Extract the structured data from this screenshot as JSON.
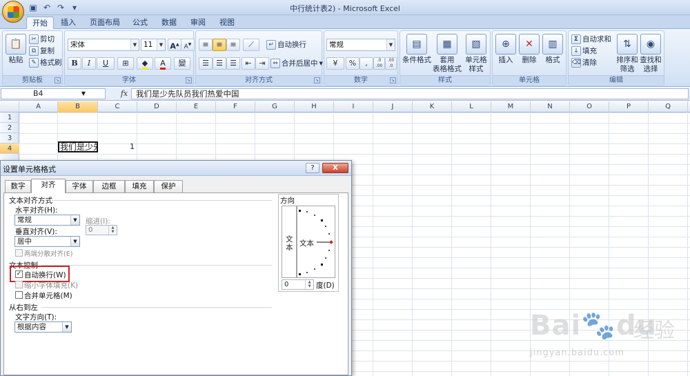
{
  "window": {
    "title": "中行统计表2) - Microsoft Excel"
  },
  "ribbon_tabs": [
    "开始",
    "插入",
    "页面布局",
    "公式",
    "数据",
    "审阅",
    "视图"
  ],
  "clipboard": {
    "paste": "粘贴",
    "cut": "剪切",
    "copy": "复制",
    "format_painter": "格式刷",
    "label": "剪贴板"
  },
  "font": {
    "name": "宋体",
    "size": "11",
    "grow": "A",
    "shrink": "A",
    "bold": "B",
    "italic": "I",
    "underline": "U",
    "label": "字体",
    "phonetic": "變"
  },
  "alignment": {
    "wrap_text": "自动换行",
    "merge_center": "合并后居中",
    "label": "对齐方式"
  },
  "number": {
    "format": "常规",
    "percent": "%",
    "comma": ",",
    "inc_decimal": ".0 .00",
    "dec_decimal": ".00 .0",
    "currency": "¥",
    "label": "数字"
  },
  "styles": {
    "conditional": [
      "条件格式",
      ""
    ],
    "table": [
      "套用",
      "表格格式"
    ],
    "cell": [
      "单元格",
      "样式"
    ],
    "label": "样式"
  },
  "cells": {
    "insert": "插入",
    "delete": "删除",
    "format": "格式",
    "label": "单元格"
  },
  "editing": {
    "autosum": "自动求和",
    "fill": "填充",
    "clear": "清除",
    "sort_filter": [
      "排序和",
      "筛选"
    ],
    "find_select": [
      "查找和",
      "选择"
    ],
    "label": "编辑"
  },
  "formula_bar": {
    "name_box": "B4",
    "fx": "fx",
    "content": "我们是少先队员我们热爱中国"
  },
  "sheet": {
    "columns": [
      "A",
      "B",
      "C",
      "D",
      "E",
      "F",
      "G",
      "H",
      "I",
      "J",
      "K",
      "L",
      "M",
      "N",
      "O",
      "P",
      "Q"
    ],
    "rows": [
      "1",
      "2",
      "3",
      "4"
    ],
    "selected_column": "B",
    "selected_row": "4",
    "cell_B4": "我们是少先队员我们热爱中国",
    "cell_C4": "1"
  },
  "dialog": {
    "title": "设置单元格格式",
    "help": "?",
    "close": "X",
    "tabs": [
      "数字",
      "对齐",
      "字体",
      "边框",
      "填充",
      "保护"
    ],
    "active_tab": "对齐",
    "text_alignment_heading": "文本对齐方式",
    "horizontal_label": "水平对齐(H):",
    "horizontal_value": "常规",
    "indent_label": "缩进(I):",
    "indent_value": "0",
    "vertical_label": "垂直对齐(V):",
    "vertical_value": "居中",
    "justify_distributed": "两端分散对齐(E)",
    "text_control_heading": "文本控制",
    "wrap_text": "自动换行(W)",
    "wrap_text_checked": true,
    "shrink_to_fit": "缩小字体填充(K)",
    "merge_cells": "合并单元格(M)",
    "rtl_heading": "从右到左",
    "text_direction_label": "文字方向(T):",
    "text_direction_value": "根据内容",
    "orientation_heading": "方向",
    "orientation_vertical_text": "文本",
    "orientation_text": "文本",
    "degrees_value": "0",
    "degrees_label": "度(D)"
  },
  "watermark": {
    "brand": "Bai",
    "brand2": "du",
    "cn": "经验",
    "url": "jingyan.baidu.com"
  }
}
